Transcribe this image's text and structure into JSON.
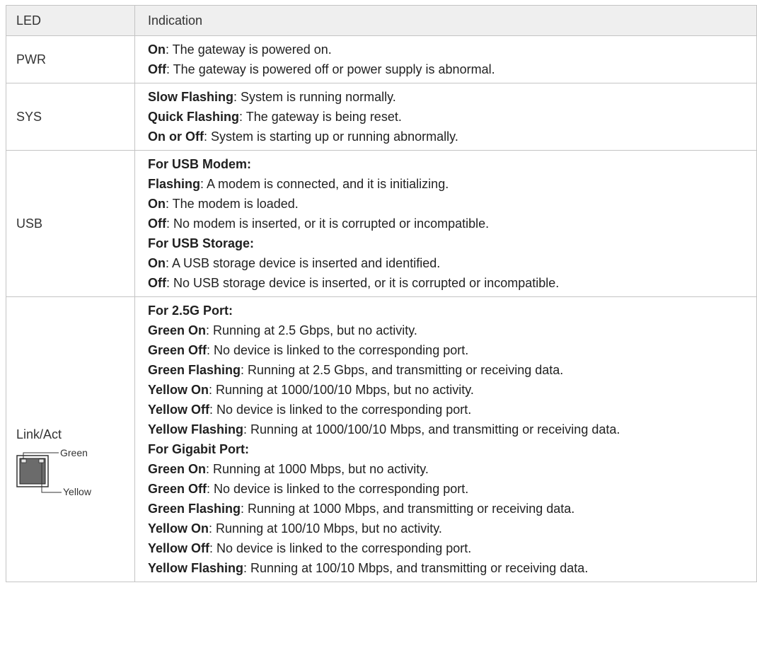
{
  "table": {
    "headers": {
      "led": "LED",
      "indication": "Indication"
    },
    "rows": [
      {
        "led": "PWR",
        "lines": [
          {
            "term": "On",
            "text": ": The gateway is powered on."
          },
          {
            "term": "Off",
            "text": ": The gateway is powered off or power supply is abnormal."
          }
        ]
      },
      {
        "led": "SYS",
        "lines": [
          {
            "term": "Slow Flashing",
            "text": ": System is running normally."
          },
          {
            "term": "Quick Flashing",
            "text": ": The gateway is being reset."
          },
          {
            "term": "On or Off",
            "text": ": System is starting up or running abnormally."
          }
        ]
      },
      {
        "led": "USB",
        "lines": [
          {
            "term": "For USB Modem:",
            "text": ""
          },
          {
            "term": "Flashing",
            "text": ": A modem is connected, and it is initializing."
          },
          {
            "term": "On",
            "text": ": The modem is loaded."
          },
          {
            "term": "Off",
            "text": ": No modem is inserted, or it is corrupted or incompatible."
          },
          {
            "term": "For USB Storage:",
            "text": ""
          },
          {
            "term": "On",
            "text": ": A USB storage device is inserted and identified."
          },
          {
            "term": "Off",
            "text": ": No USB storage device is inserted, or it is corrupted or incompatible."
          }
        ]
      },
      {
        "led": "Link/Act",
        "diagram": {
          "green_label": "Green",
          "yellow_label": "Yellow"
        },
        "lines": [
          {
            "term": "For 2.5G Port:",
            "text": ""
          },
          {
            "term": "Green On",
            "text": ": Running at 2.5 Gbps, but no activity."
          },
          {
            "term": "Green Off",
            "text": ": No device is linked to the corresponding port."
          },
          {
            "term": "Green Flashing",
            "text": ": Running at 2.5 Gbps, and transmitting or receiving data."
          },
          {
            "term": "Yellow On",
            "text": ": Running at 1000/100/10 Mbps, but no activity."
          },
          {
            "term": "Yellow Off",
            "text": ": No device is linked to the corresponding port."
          },
          {
            "term": "Yellow Flashing",
            "text": ": Running at 1000/100/10 Mbps, and transmitting or receiving data."
          },
          {
            "term": "For Gigabit Port:",
            "text": ""
          },
          {
            "term": "Green On",
            "text": ": Running at 1000 Mbps, but no activity."
          },
          {
            "term": "Green Off",
            "text": ": No device is linked to the corresponding port."
          },
          {
            "term": "Green Flashing",
            "text": ": Running at 1000 Mbps, and transmitting or receiving data."
          },
          {
            "term": "Yellow On",
            "text": ": Running at 100/10 Mbps, but no activity."
          },
          {
            "term": "Yellow Off",
            "text": ": No device is linked to the corresponding port."
          },
          {
            "term": "Yellow Flashing",
            "text": ": Running at 100/10 Mbps, and transmitting or receiving data."
          }
        ]
      }
    ]
  }
}
